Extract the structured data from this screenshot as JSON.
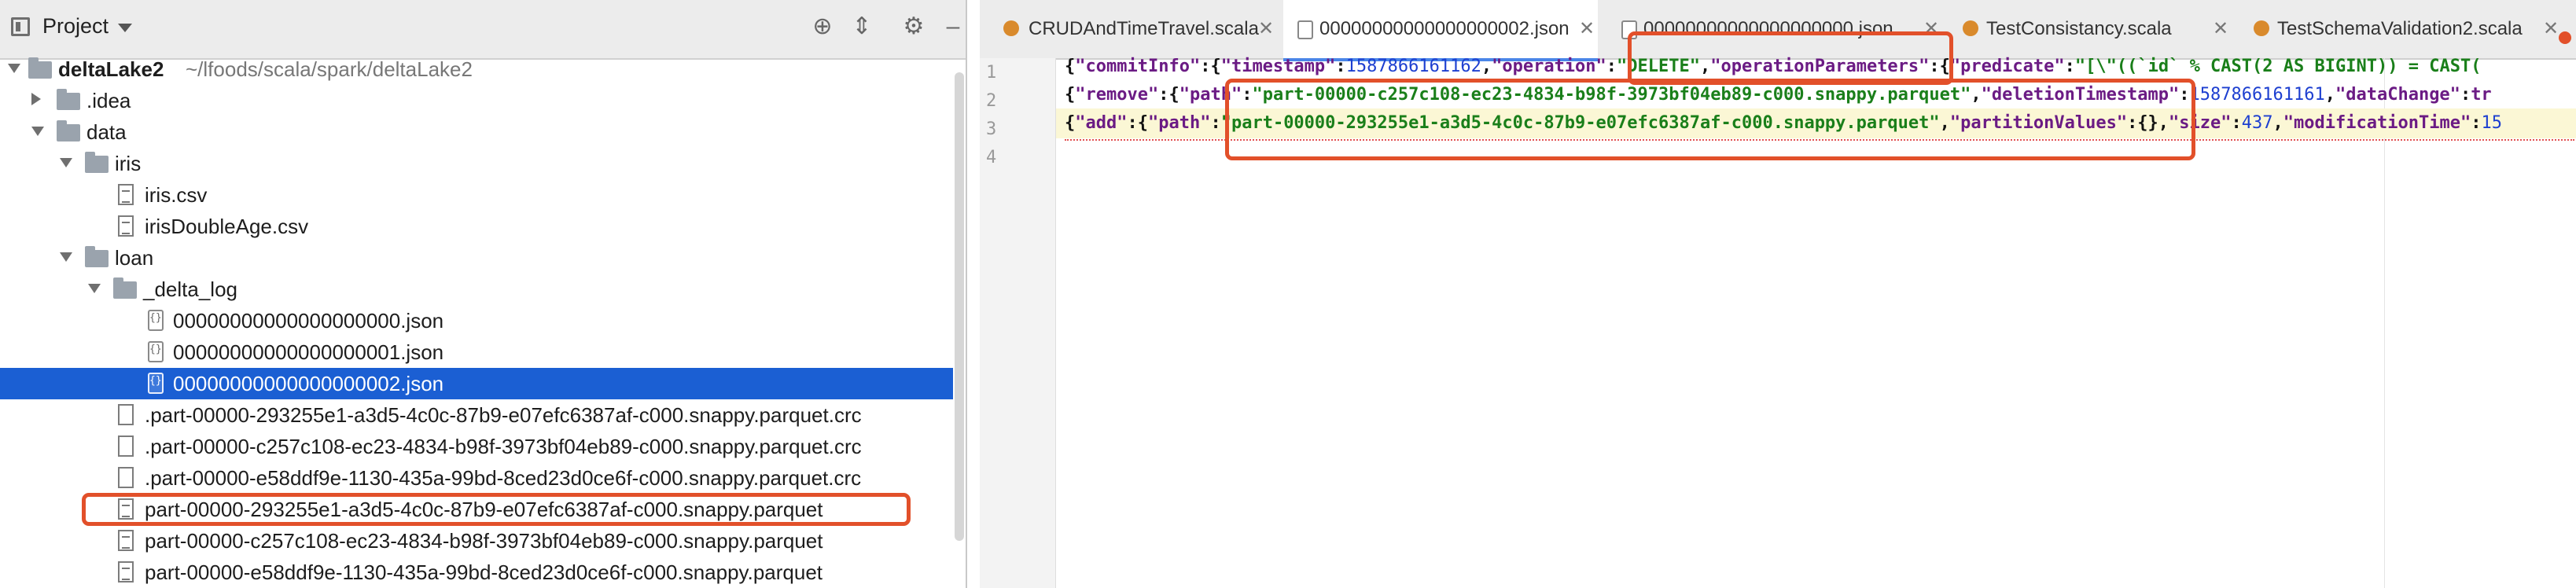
{
  "project_panel": {
    "title": "Project",
    "root": {
      "name": "deltaLake2",
      "path": "~/lfoods/scala/spark/deltaLake2"
    },
    "items": [
      {
        "label": "deltaLake2",
        "extra": "~/lfoods/scala/spark/deltaLake2",
        "kind": "folder"
      },
      {
        "label": ".idea",
        "kind": "folder"
      },
      {
        "label": "data",
        "kind": "folder"
      },
      {
        "label": "iris",
        "kind": "folder"
      },
      {
        "label": "iris.csv",
        "kind": "file"
      },
      {
        "label": "irisDoubleAge.csv",
        "kind": "file"
      },
      {
        "label": "loan",
        "kind": "folder"
      },
      {
        "label": "_delta_log",
        "kind": "folder"
      },
      {
        "label": "00000000000000000000.json",
        "kind": "json"
      },
      {
        "label": "00000000000000000001.json",
        "kind": "json"
      },
      {
        "label": "00000000000000000002.json",
        "kind": "json",
        "selected": true
      },
      {
        "label": ".part-00000-293255e1-a3d5-4c0c-87b9-e07efc6387af-c000.snappy.parquet.crc",
        "kind": "file"
      },
      {
        "label": ".part-00000-c257c108-ec23-4834-b98f-3973bf04eb89-c000.snappy.parquet.crc",
        "kind": "file"
      },
      {
        "label": ".part-00000-e58ddf9e-1130-435a-99bd-8ced23d0ce6f-c000.snappy.parquet.crc",
        "kind": "file"
      },
      {
        "label": "part-00000-293255e1-a3d5-4c0c-87b9-e07efc6387af-c000.snappy.parquet",
        "kind": "file",
        "highlighted": true
      },
      {
        "label": "part-00000-c257c108-ec23-4834-b98f-3973bf04eb89-c000.snappy.parquet",
        "kind": "file"
      },
      {
        "label": "part-00000-e58ddf9e-1130-435a-99bd-8ced23d0ce6f-c000.snappy.parquet",
        "kind": "file"
      }
    ]
  },
  "tabs": [
    {
      "label": "CRUDAndTimeTravel.scala",
      "kind": "scala"
    },
    {
      "label": "00000000000000000002.json",
      "kind": "json",
      "active": true
    },
    {
      "label": "00000000000000000000.json",
      "kind": "json"
    },
    {
      "label": "TestConsistancy.scala",
      "kind": "scala"
    },
    {
      "label": "TestSchemaValidation2.scala",
      "kind": "scala"
    }
  ],
  "editor": {
    "line_numbers": [
      "1",
      "2",
      "3",
      "4"
    ],
    "line1": {
      "a": "{",
      "k1": "\"commitInfo\"",
      "p1": ":{",
      "k2": "\"timestamp\"",
      "p2": ":",
      "n1": "1587866161162",
      "p3": ",",
      "k3": "\"operation\"",
      "p4": ":",
      "s1": "\"DELETE\"",
      "p5": ",",
      "k4": "\"operationParameters\"",
      "p6": ":{",
      "k5": "\"predicate\"",
      "p7": ":",
      "s2": "\"[\\\"((`id` % CAST(2 AS BIGINT)) = CAST("
    },
    "line2": {
      "a": "{",
      "k1": "\"remove\"",
      "p1": ":{",
      "k2": "\"path\"",
      "p2": ":",
      "s1": "\"part-00000-c257c108-ec23-4834-b98f-3973bf04eb89-c000.snappy.parquet\"",
      "p3": ",",
      "k3": "\"deletionTimestamp\"",
      "p4": ":",
      "n1": "1587866161161",
      "p5": ",",
      "k4": "\"dataChange\"",
      "p6": ":",
      "n2": "tr"
    },
    "line3": {
      "a": "{",
      "k1": "\"add\"",
      "p1": ":{",
      "k2": "\"path\"",
      "p2": ":",
      "s1": "\"part-00000-293255e1-a3d5-4c0c-87b9-e07efc6387af-c000.snappy.parquet\"",
      "p3": ",",
      "k3": "\"partitionValues\"",
      "p4": ":{},",
      "k4": "\"size\"",
      "p5": ":",
      "n1": "437",
      "p6": ",",
      "k5": "\"modificationTime\"",
      "p7": ":",
      "n2": "15"
    }
  },
  "colors": {
    "selection": "#1b5fd3",
    "highlight_box": "#e2502a",
    "string": "#1a7f1a",
    "key": "#6b1b84",
    "number": "#1d3fd0"
  }
}
